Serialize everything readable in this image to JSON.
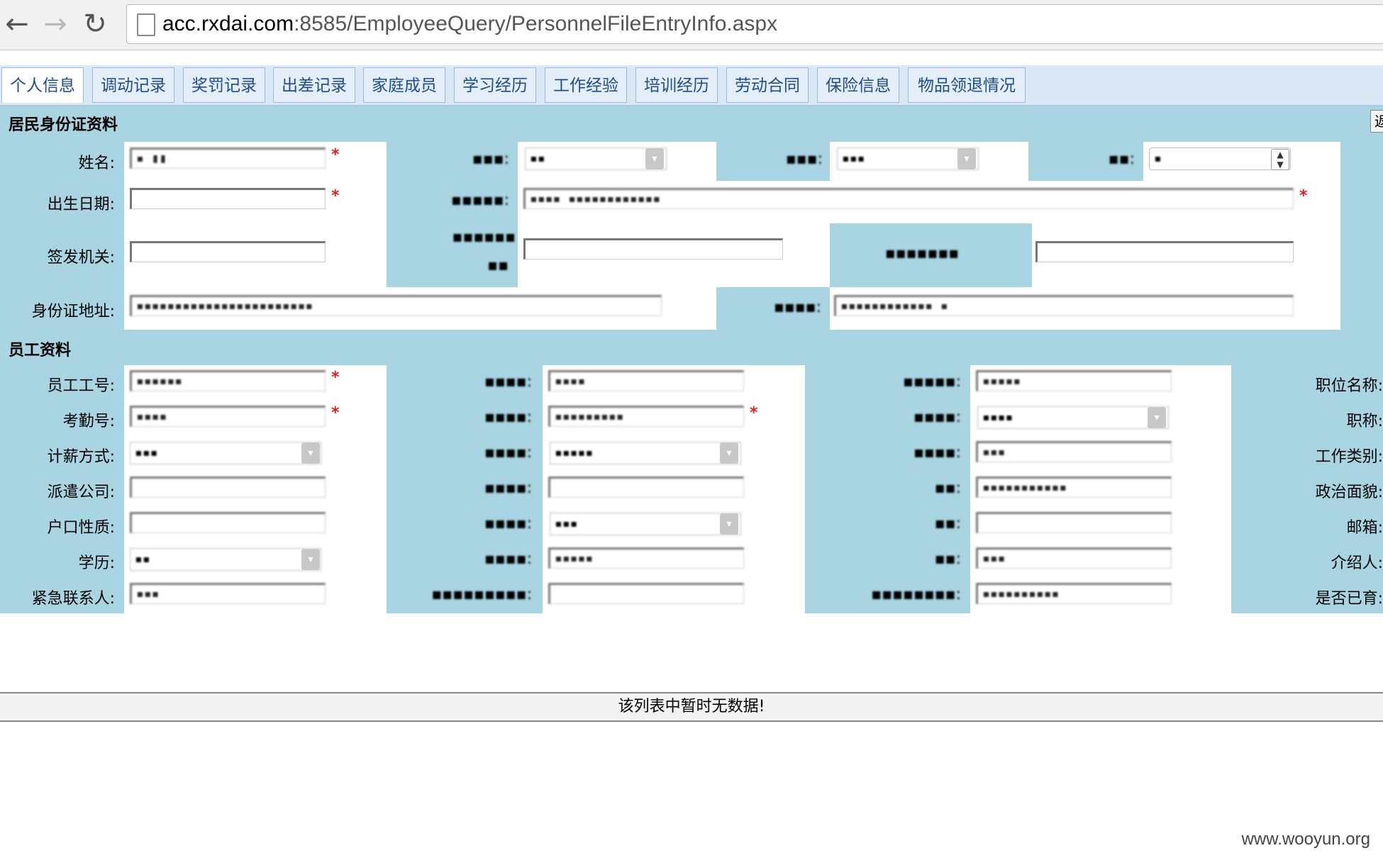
{
  "browser": {
    "url_host": "acc.rxdai.com",
    "url_path": ":8585/EmployeeQuery/PersonnelFileEntryInfo.aspx",
    "back_icon": "←",
    "forward_icon": "→",
    "reload_icon": "↻"
  },
  "tabs": [
    {
      "label": "个人信息"
    },
    {
      "label": "调动记录"
    },
    {
      "label": "奖罚记录"
    },
    {
      "label": "出差记录"
    },
    {
      "label": "家庭成员"
    },
    {
      "label": "学习经历"
    },
    {
      "label": "工作经验"
    },
    {
      "label": "培训经历"
    },
    {
      "label": "劳动合同"
    },
    {
      "label": "保险信息"
    },
    {
      "label": "物品领退情况"
    }
  ],
  "return_button": "返",
  "id_section": {
    "title": "居民身份证资料",
    "name_label": "姓名:",
    "name_value": "▪ ▮▮",
    "gender_label": "▪▪▪:",
    "gender_value": "▪▪",
    "ethnic_label": "▪▪▪:",
    "ethnic_value": "▪▪▪",
    "marital_label": "▪▪:",
    "marital_value": "▪",
    "birth_label": "出生日期:",
    "birth_value": "",
    "idnum_label": "▪▪▪▪▪:",
    "idnum_value": "▪▪▪▪ ▪▪▪▪▪▪▪▪▪▪▪▪",
    "issuer_label": "签发机关:",
    "issuer_value": "",
    "valid_from_label": "▪▪▪▪▪▪",
    "valid_from_label2": "▪▪",
    "valid_to_label": "▪▪▪▪▪▪▪",
    "address_label": "身份证地址:",
    "address_value": "▪▪▪▪▪▪▪▪▪▪▪▪▪▪▪▪▪▪▪▪▪▪▪",
    "current_addr_label": "▪▪▪▪:",
    "current_addr_value": "▪▪▪▪▪▪▪▪▪▪▪▪ ▪"
  },
  "emp_section": {
    "title": "员工资料",
    "labels_left": [
      "员工工号:",
      "考勤号:",
      "计薪方式:",
      "派遣公司:",
      "户口性质:",
      "学历:",
      "紧急联系人:"
    ],
    "values_left": [
      "▪▪▪▪▪▪",
      "▪▪▪▪",
      "▪▪▪",
      "",
      "",
      "▪▪",
      "▪▪▪"
    ],
    "labels_mid": [
      "▪▪▪▪:",
      "▪▪▪▪:",
      "▪▪▪▪:",
      "▪▪▪▪:",
      "▪▪▪▪:",
      "▪▪▪▪:",
      "▪▪▪▪▪▪▪▪▪:"
    ],
    "values_mid": [
      "▪▪▪▪",
      "▪▪▪▪▪▪▪▪▪",
      "▪▪▪▪▪",
      "",
      "▪▪▪",
      "▪▪▪▪▪",
      ""
    ],
    "labels_r": [
      "▪▪▪▪▪:",
      "▪▪▪▪:",
      "▪▪▪▪:",
      "▪▪:",
      "▪▪:",
      "▪▪:",
      "▪▪▪▪▪▪▪▪:"
    ],
    "values_r": [
      "▪▪▪▪▪",
      "▪▪▪▪",
      "▪▪▪",
      "▪▪▪▪▪▪▪▪▪▪▪",
      "",
      "▪▪▪",
      "▪▪▪▪▪▪▪▪▪▪"
    ],
    "labels_far": [
      "职位名称:",
      "职称:",
      "工作类别:",
      "政治面貌:",
      "邮箱:",
      "介绍人:",
      "是否已育:"
    ]
  },
  "grid": {
    "empty_message": "该列表中暂时无数据!"
  },
  "watermark": "www.wooyun.org"
}
